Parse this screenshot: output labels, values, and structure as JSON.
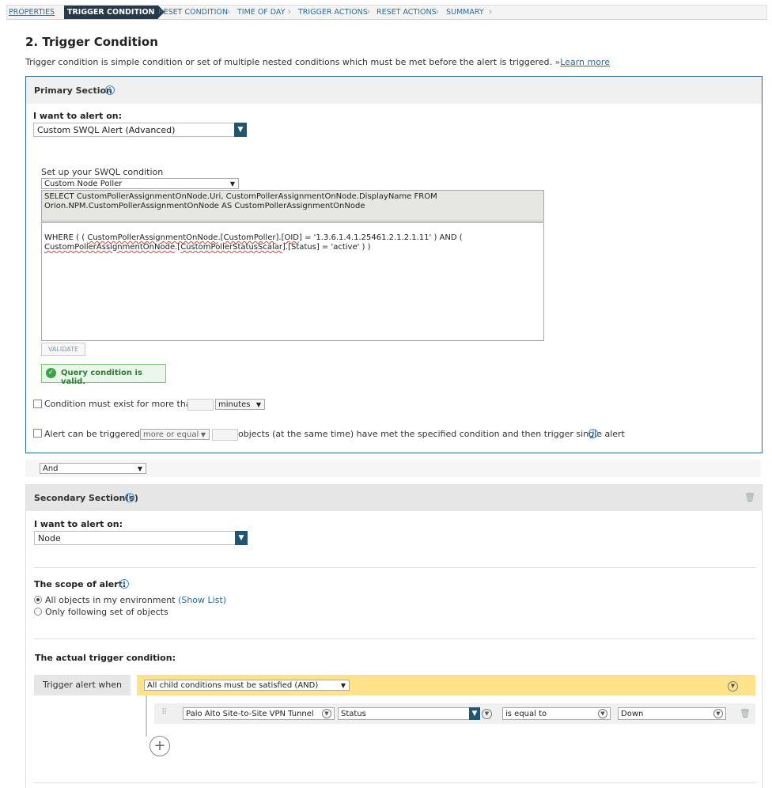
{
  "wizard": {
    "steps": [
      "PROPERTIES",
      "TRIGGER CONDITION",
      "RESET CONDITION",
      "TIME OF DAY",
      "TRIGGER ACTIONS",
      "RESET ACTIONS",
      "SUMMARY"
    ]
  },
  "page": {
    "title": "2. Trigger Condition",
    "description": "Trigger condition is simple condition or set of multiple nested conditions which must be met before the alert is triggered.",
    "learn_more_prefix": "»",
    "learn_more": "Learn more"
  },
  "primary": {
    "title": "Primary Section",
    "alert_on_label": "I want to alert on:",
    "alert_on_value": "Custom SWQL Alert (Advanced)",
    "swql_label": "Set up your SWQL condition",
    "swql_type": "Custom Node Poller",
    "sql_select_1": "SELECT CustomPollerAssignmentOnNode.Uri, CustomPollerAssignmentOnNode.DisplayName FROM",
    "sql_select_2": "Orion.NPM.CustomPollerAssignmentOnNode AS CustomPollerAssignmentOnNode",
    "sql_where_a": "WHERE ( ( ",
    "sql_where_b": "CustomPollerAssignmentOnNode",
    "sql_where_c": ".[",
    "sql_where_d": "CustomPoller",
    "sql_where_e": "].[",
    "sql_where_f": "OID",
    "sql_where_g": "] = '1.3.6.1.4.1.25461.2.1.2.1.11' ) AND (",
    "sql_where2_a": "CustomPollerAssignmentOnNode",
    "sql_where2_b": ".[",
    "sql_where2_c": "CustomPollerStatusScalar",
    "sql_where2_d": "].[Status] = 'active' ) )",
    "validate": "VALIDATE",
    "valid_msg": "Query condition is valid.",
    "exist_label": "Condition must exist for more than",
    "exist_unit": "minutes",
    "trigger_prefix": "Alert can be triggered if",
    "trigger_operator": "more or equal",
    "trigger_suffix": "objects (at the same time) have met the specified condition and then trigger single alert"
  },
  "join_operator": "And",
  "secondary": {
    "title": "Secondary Section(s)",
    "alert_on_label": "I want to alert on:",
    "alert_on_value": "Node",
    "scope_label": "The scope of alert:",
    "scope_all": "All objects in my environment",
    "show_list": "(Show List)",
    "scope_only": "Only following set of objects",
    "actual_label": "The actual trigger condition:",
    "trigger_when": "Trigger alert when",
    "group_op": "All child conditions must be satisfied (AND)",
    "cond_object": "Palo Alto Site-to-Site VPN Tunnel",
    "cond_field": "Status",
    "cond_op": "is equal to",
    "cond_value": "Down"
  }
}
